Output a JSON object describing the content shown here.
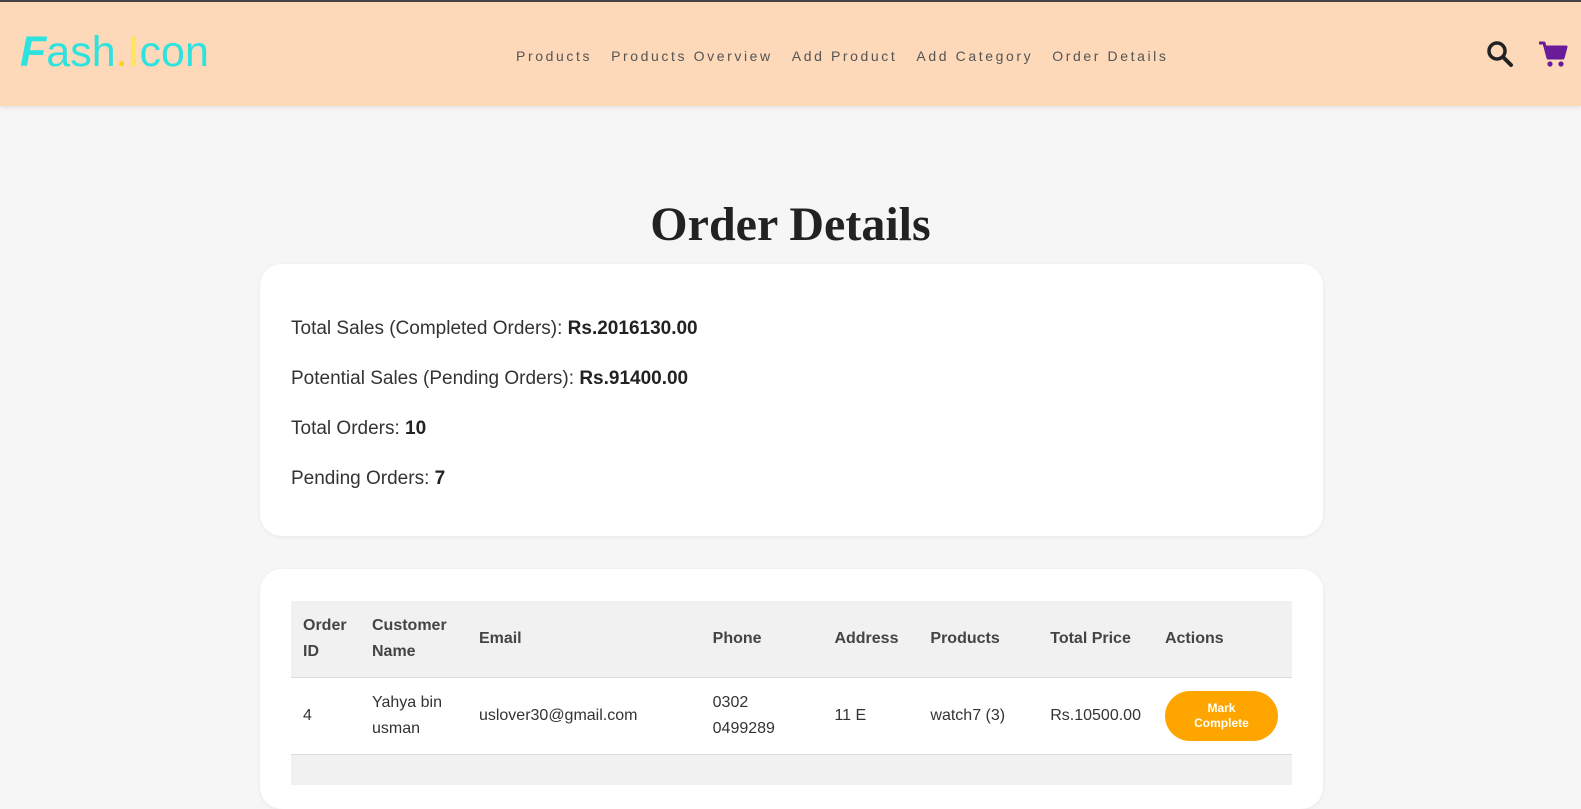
{
  "colors": {
    "header_bg": "#fdd8b9",
    "logo": "#2ee3df",
    "accent": "#ffa500",
    "cart": "#6a1b9a"
  },
  "brand": {
    "logo_f": "F",
    "logo_ash": "ash",
    "logo_dot": ".",
    "logo_i": "I",
    "logo_con": "con"
  },
  "nav": {
    "items": [
      "Products",
      "Products Overview",
      "Add Product",
      "Add Category",
      "Order Details"
    ]
  },
  "icons": {
    "search": "search-icon",
    "cart": "cart-icon"
  },
  "page": {
    "title": "Order Details"
  },
  "stats": {
    "total_sales_label": "Total Sales (Completed Orders): ",
    "total_sales_value": "Rs.2016130.00",
    "potential_sales_label": "Potential Sales (Pending Orders): ",
    "potential_sales_value": "Rs.91400.00",
    "total_orders_label": "Total Orders: ",
    "total_orders_value": "10",
    "pending_orders_label": "Pending Orders: ",
    "pending_orders_value": "7"
  },
  "table": {
    "headers": {
      "order_id_1": "Order",
      "order_id_2": "ID",
      "customer_1": "Customer",
      "customer_2": "Name",
      "email": "Email",
      "phone": "Phone",
      "address": "Address",
      "products": "Products",
      "total_price": "Total Price",
      "actions": "Actions"
    },
    "rows": [
      {
        "order_id": "4",
        "customer_1": "Yahya bin",
        "customer_2": "usman",
        "email": "uslover30@gmail.com",
        "phone_1": "0302",
        "phone_2": "0499289",
        "address": "11 E",
        "products": "watch7 (3)",
        "total_price": "Rs.10500.00",
        "action_1": "Mark",
        "action_2": "Complete"
      }
    ]
  }
}
